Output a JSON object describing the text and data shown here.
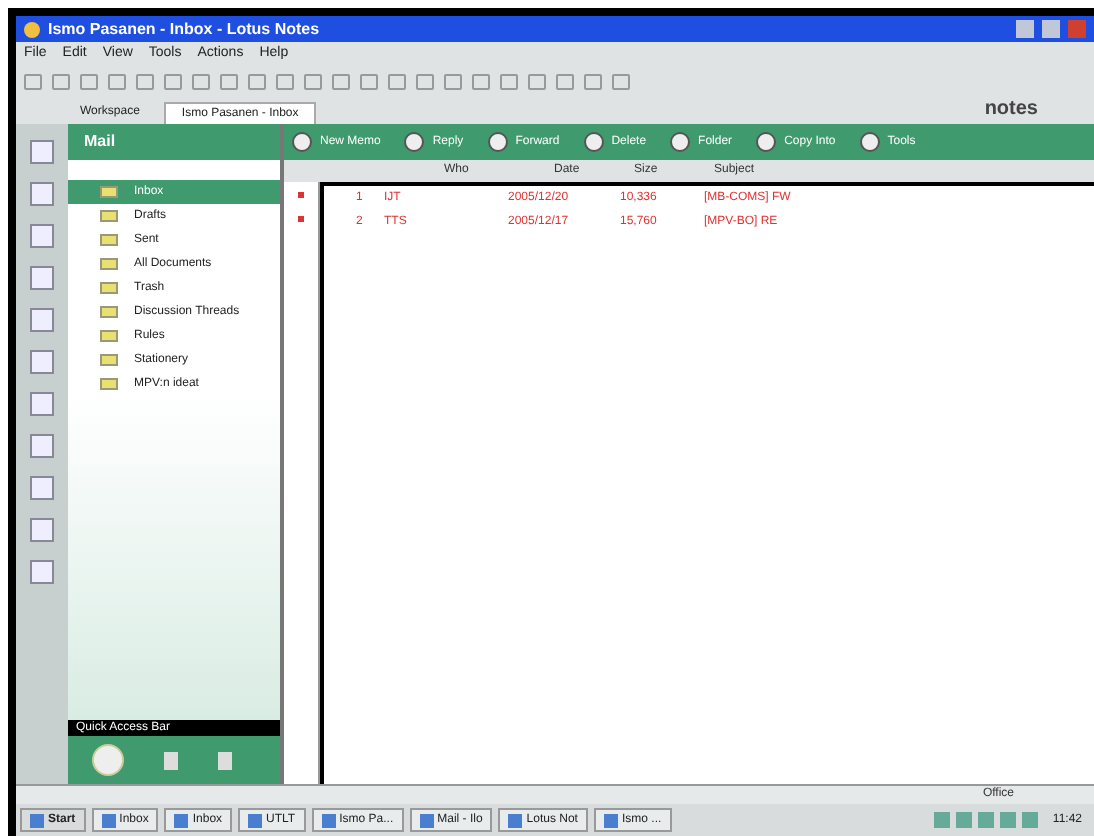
{
  "window": {
    "title": "Ismo Pasanen - Inbox - Lotus Notes"
  },
  "menu": [
    "File",
    "Edit",
    "View",
    "Tools",
    "Actions",
    "Help"
  ],
  "tabs": [
    {
      "label": "Workspace",
      "selected": false
    },
    {
      "label": "Ismo Pasanen - Inbox",
      "selected": true
    }
  ],
  "brand": "notes",
  "sidebar": {
    "title": "Mail",
    "items": [
      {
        "label": "Inbox",
        "selected": true
      },
      {
        "label": "Drafts",
        "selected": false
      },
      {
        "label": "Sent",
        "selected": false
      },
      {
        "label": "All Documents",
        "selected": false
      },
      {
        "label": "Trash",
        "selected": false
      },
      {
        "label": "Discussion Threads",
        "selected": false
      },
      {
        "label": "Rules",
        "selected": false
      },
      {
        "label": "Stationery",
        "selected": false
      },
      {
        "label": "MPV:n ideat",
        "selected": false
      }
    ],
    "footer": "Quick Access Bar"
  },
  "actions": [
    "New Memo",
    "Reply",
    "Forward",
    "Delete",
    "Folder",
    "Copy Into",
    "Tools"
  ],
  "table": {
    "columns": [
      "Who",
      "Date",
      "Size",
      "Subject"
    ],
    "rows": [
      {
        "num": "1",
        "who": "IJT",
        "date": "2005/12/20",
        "size": "10,336",
        "subject": "[MB-COMS] FW",
        "unread": true
      },
      {
        "num": "2",
        "who": "TTS",
        "date": "2005/12/17",
        "size": "15,760",
        "subject": "[MPV-BO] RE",
        "unread": true
      }
    ]
  },
  "status": "Office",
  "taskbar": {
    "items": [
      "Start",
      "Inbox",
      "Inbox",
      "UTLT",
      "Ismo Pa...",
      "Mail - Ilo",
      "Lotus Not",
      "Ismo ..."
    ],
    "clock": "11:42"
  }
}
